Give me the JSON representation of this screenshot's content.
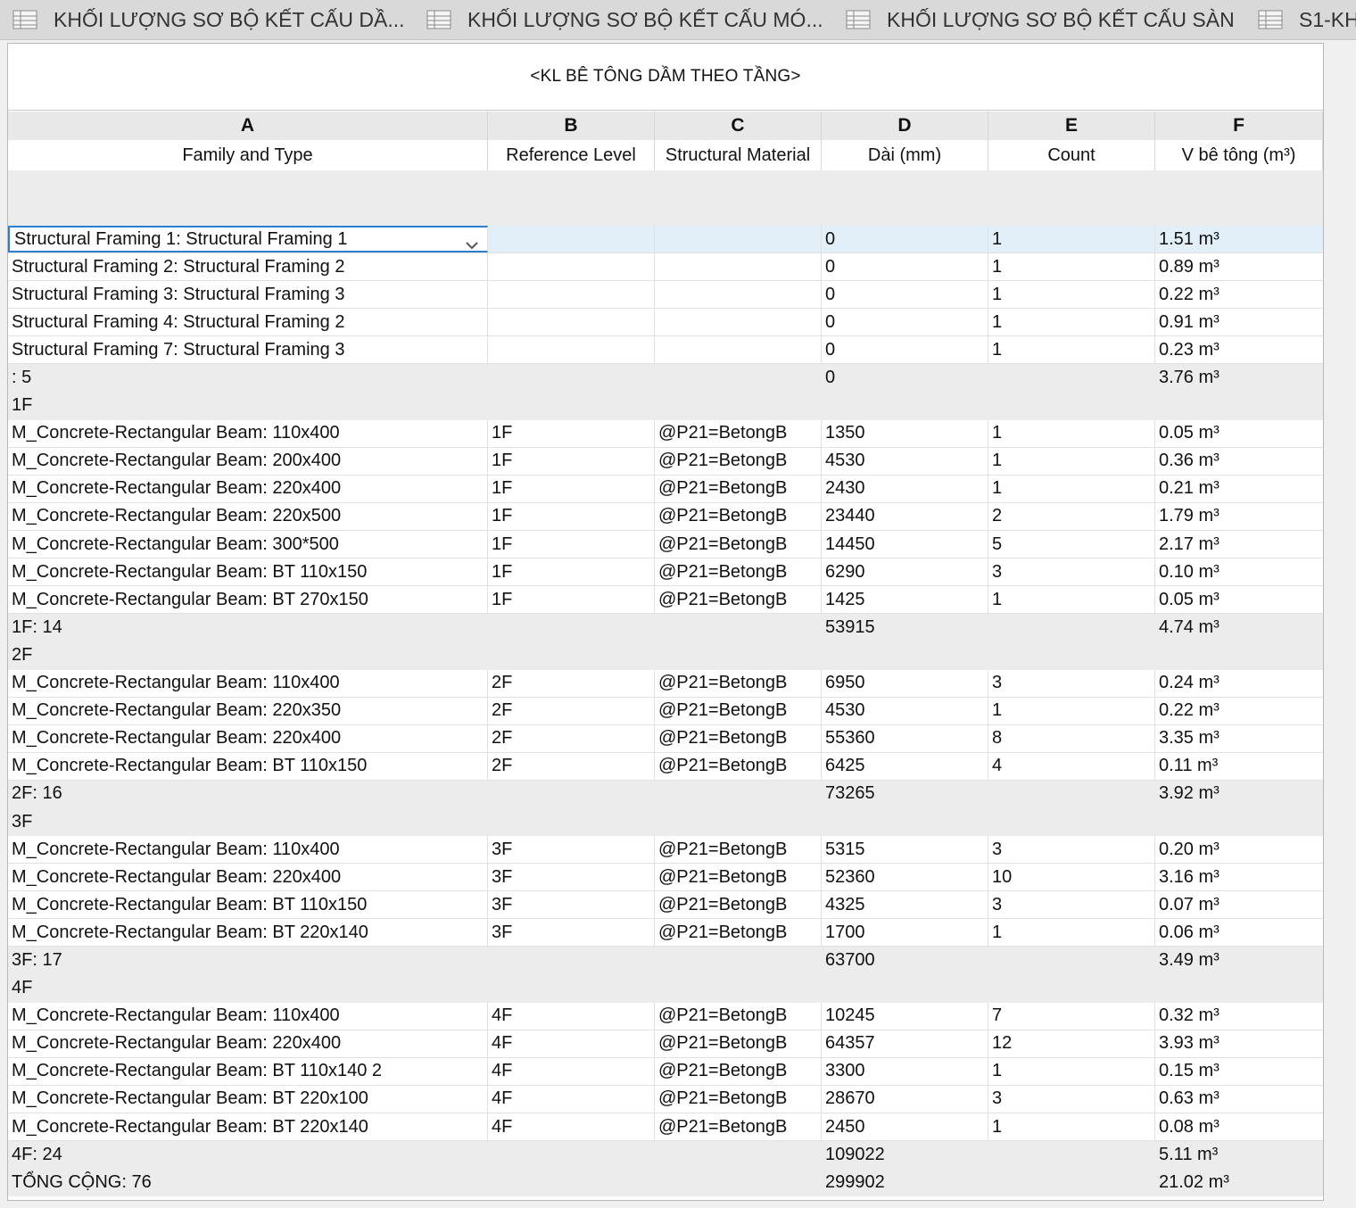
{
  "tabs": [
    {
      "label": "KHỐI LƯỢNG SƠ BỘ KẾT CẤU DẦ...",
      "icon": "schedule-icon"
    },
    {
      "label": "KHỐI LƯỢNG SƠ BỘ KẾT CẤU MÓ...",
      "icon": "schedule-icon"
    },
    {
      "label": "KHỐI LƯỢNG SƠ BỘ KẾT CẤU SÀN",
      "icon": "schedule-icon"
    },
    {
      "label": "S1-KH",
      "icon": "schedule-icon"
    }
  ],
  "schedule": {
    "title": "<KL BÊ TÔNG DẦM THEO TẦNG>",
    "column_letters": [
      "A",
      "B",
      "C",
      "D",
      "E",
      "F"
    ],
    "column_headers": [
      "Family and Type",
      "Reference Level",
      "Structural Material",
      "Dài (mm)",
      "Count",
      "V bê tông (m³)"
    ],
    "rows": [
      {
        "type": "data",
        "selected": true,
        "cells": [
          "Structural Framing 1: Structural Framing 1",
          "",
          "",
          "0",
          "1",
          "1.51 m³"
        ]
      },
      {
        "type": "data",
        "cells": [
          "Structural Framing 2: Structural Framing 2",
          "",
          "",
          "0",
          "1",
          "0.89 m³"
        ]
      },
      {
        "type": "data",
        "cells": [
          "Structural Framing 3: Structural Framing 3",
          "",
          "",
          "0",
          "1",
          "0.22 m³"
        ]
      },
      {
        "type": "data",
        "cells": [
          "Structural Framing 4: Structural Framing 2",
          "",
          "",
          "0",
          "1",
          "0.91 m³"
        ]
      },
      {
        "type": "data",
        "cells": [
          "Structural Framing 7: Structural Framing 3",
          "",
          "",
          "0",
          "1",
          "0.23 m³"
        ]
      },
      {
        "type": "group",
        "cells": [
          ": 5",
          "",
          "",
          "0",
          "",
          "3.76 m³"
        ]
      },
      {
        "type": "group",
        "cells": [
          "1F",
          "",
          "",
          "",
          "",
          ""
        ]
      },
      {
        "type": "data",
        "cells": [
          "M_Concrete-Rectangular Beam: 110x400",
          "1F",
          "@P21=BetongB",
          "1350",
          "1",
          "0.05 m³"
        ]
      },
      {
        "type": "data",
        "cells": [
          "M_Concrete-Rectangular Beam: 200x400",
          "1F",
          "@P21=BetongB",
          "4530",
          "1",
          "0.36 m³"
        ]
      },
      {
        "type": "data",
        "cells": [
          "M_Concrete-Rectangular Beam: 220x400",
          "1F",
          "@P21=BetongB",
          "2430",
          "1",
          "0.21 m³"
        ]
      },
      {
        "type": "data",
        "cells": [
          "M_Concrete-Rectangular Beam: 220x500",
          "1F",
          "@P21=BetongB",
          "23440",
          "2",
          "1.79 m³"
        ]
      },
      {
        "type": "data",
        "cells": [
          "M_Concrete-Rectangular Beam: 300*500",
          "1F",
          "@P21=BetongB",
          "14450",
          "5",
          "2.17 m³"
        ]
      },
      {
        "type": "data",
        "cells": [
          "M_Concrete-Rectangular Beam: BT 110x150",
          "1F",
          "@P21=BetongB",
          "6290",
          "3",
          "0.10 m³"
        ]
      },
      {
        "type": "data",
        "cells": [
          "M_Concrete-Rectangular Beam: BT 270x150",
          "1F",
          "@P21=BetongB",
          "1425",
          "1",
          "0.05 m³"
        ]
      },
      {
        "type": "group",
        "cells": [
          "1F: 14",
          "",
          "",
          "53915",
          "",
          "4.74 m³"
        ]
      },
      {
        "type": "group",
        "cells": [
          "2F",
          "",
          "",
          "",
          "",
          ""
        ]
      },
      {
        "type": "data",
        "cells": [
          "M_Concrete-Rectangular Beam: 110x400",
          "2F",
          "@P21=BetongB",
          "6950",
          "3",
          "0.24 m³"
        ]
      },
      {
        "type": "data",
        "cells": [
          "M_Concrete-Rectangular Beam: 220x350",
          "2F",
          "@P21=BetongB",
          "4530",
          "1",
          "0.22 m³"
        ]
      },
      {
        "type": "data",
        "cells": [
          "M_Concrete-Rectangular Beam: 220x400",
          "2F",
          "@P21=BetongB",
          "55360",
          "8",
          "3.35 m³"
        ]
      },
      {
        "type": "data",
        "cells": [
          "M_Concrete-Rectangular Beam: BT 110x150",
          "2F",
          "@P21=BetongB",
          "6425",
          "4",
          "0.11 m³"
        ]
      },
      {
        "type": "group",
        "cells": [
          "2F: 16",
          "",
          "",
          "73265",
          "",
          "3.92 m³"
        ]
      },
      {
        "type": "group",
        "cells": [
          "3F",
          "",
          "",
          "",
          "",
          ""
        ]
      },
      {
        "type": "data",
        "cells": [
          "M_Concrete-Rectangular Beam: 110x400",
          "3F",
          "@P21=BetongB",
          "5315",
          "3",
          "0.20 m³"
        ]
      },
      {
        "type": "data",
        "cells": [
          "M_Concrete-Rectangular Beam: 220x400",
          "3F",
          "@P21=BetongB",
          "52360",
          "10",
          "3.16 m³"
        ]
      },
      {
        "type": "data",
        "cells": [
          "M_Concrete-Rectangular Beam: BT 110x150",
          "3F",
          "@P21=BetongB",
          "4325",
          "3",
          "0.07 m³"
        ]
      },
      {
        "type": "data",
        "cells": [
          "M_Concrete-Rectangular Beam: BT 220x140",
          "3F",
          "@P21=BetongB",
          "1700",
          "1",
          "0.06 m³"
        ]
      },
      {
        "type": "group",
        "cells": [
          "3F: 17",
          "",
          "",
          "63700",
          "",
          "3.49 m³"
        ]
      },
      {
        "type": "group",
        "cells": [
          "4F",
          "",
          "",
          "",
          "",
          ""
        ]
      },
      {
        "type": "data",
        "cells": [
          "M_Concrete-Rectangular Beam: 110x400",
          "4F",
          "@P21=BetongB",
          "10245",
          "7",
          "0.32 m³"
        ]
      },
      {
        "type": "data",
        "cells": [
          "M_Concrete-Rectangular Beam: 220x400",
          "4F",
          "@P21=BetongB",
          "64357",
          "12",
          "3.93 m³"
        ]
      },
      {
        "type": "data",
        "cells": [
          "M_Concrete-Rectangular Beam: BT 110x140 2",
          "4F",
          "@P21=BetongB",
          "3300",
          "1",
          "0.15 m³"
        ]
      },
      {
        "type": "data",
        "cells": [
          "M_Concrete-Rectangular Beam: BT 220x100",
          "4F",
          "@P21=BetongB",
          "28670",
          "3",
          "0.63 m³"
        ]
      },
      {
        "type": "data",
        "cells": [
          "M_Concrete-Rectangular Beam: BT 220x140",
          "4F",
          "@P21=BetongB",
          "2450",
          "1",
          "0.08 m³"
        ]
      },
      {
        "type": "group",
        "cells": [
          "4F: 24",
          "",
          "",
          "109022",
          "",
          "5.11 m³"
        ]
      },
      {
        "type": "group",
        "cells": [
          "TỔNG CỘNG: 76",
          "",
          "",
          "299902",
          "",
          "21.02 m³"
        ]
      }
    ]
  }
}
